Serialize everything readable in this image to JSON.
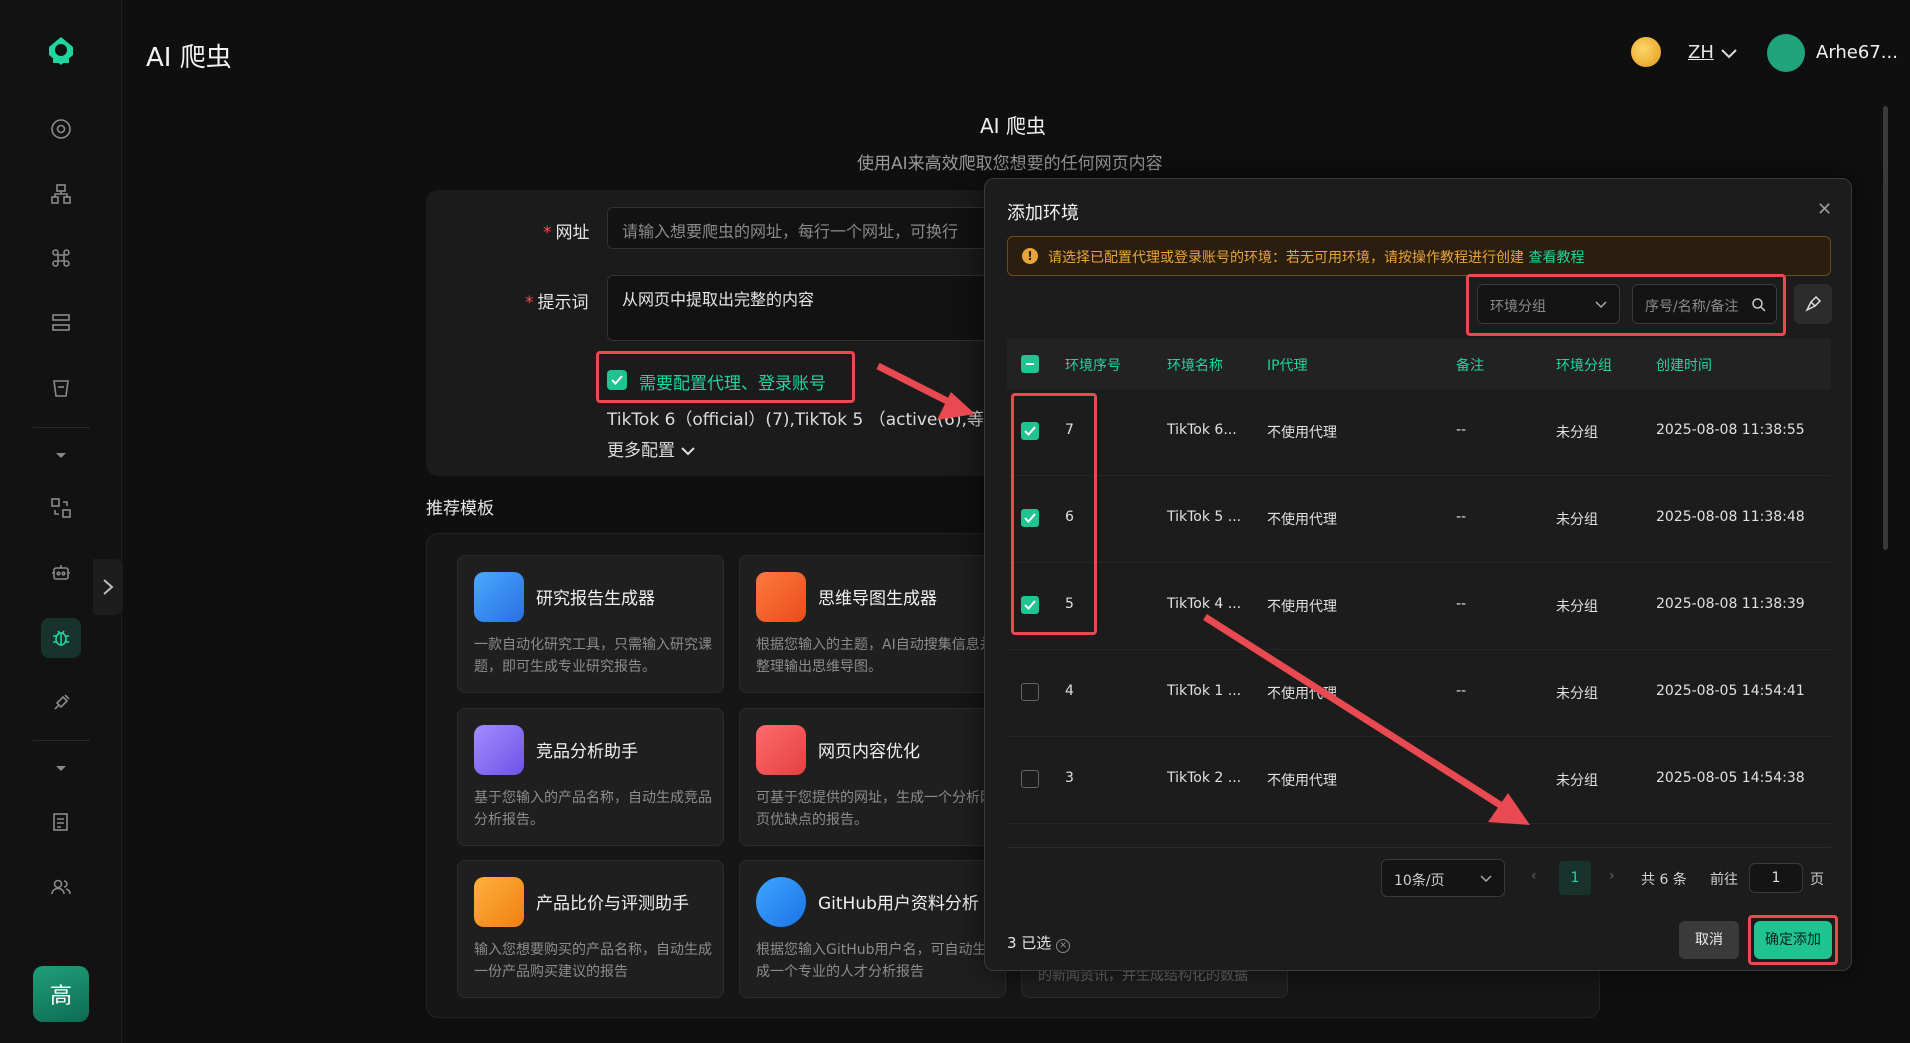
{
  "app": {
    "title": "AI 爬虫"
  },
  "header": {
    "lang": "ZH",
    "user": "Arhe67..."
  },
  "sidebar": {
    "footer_avatar": "高"
  },
  "main": {
    "title": "AI 爬虫",
    "subtitle": "使用AI来高效爬取您想要的任何网页内容",
    "url_label": "网址",
    "url_placeholder": "请输入想要爬虫的网址，每行一个网址，可换行",
    "prompt_label": "提示词",
    "prompt_value": "从网页中提取出完整的内容",
    "proxy_checkbox_label": "需要配置代理、登录账号",
    "selected_envs": "TikTok 6（official）(7),TikTok 5 （active(6),等",
    "more_config": "更多配置",
    "templates_title": "推荐模板",
    "templates": [
      {
        "title": "研究报告生成器",
        "desc": "一款自动化研究工具，只需输入研究课题，即可生成专业研究报告。"
      },
      {
        "title": "思维导图生成器",
        "desc": "根据您输入的主题，AI自动搜集信息并整理输出思维导图。"
      },
      {
        "title": "竞品分析助手",
        "desc": "基于您输入的产品名称，自动生成竞品分析报告。"
      },
      {
        "title": "网页内容优化",
        "desc": "可基于您提供的网址，生成一个分析网页优缺点的报告。"
      },
      {
        "title": "产品比价与评测助手",
        "desc": "输入您想要购买的产品名称，自动生成一份产品购买建议的报告"
      },
      {
        "title": "GitHub用户资料分析",
        "desc": "根据您输入GitHub用户名，可自动生成一个专业的人才分析报告"
      }
    ],
    "partial_card_text": "的新闻资讯，并生成结构化的数据"
  },
  "modal": {
    "title": "添加环境",
    "alert": "请选择已配置代理或登录账号的环境：若无可用环境，请按操作教程进行创建",
    "alert_link": "查看教程",
    "group_select": "环境分组",
    "search_placeholder": "序号/名称/备注",
    "columns": [
      "环境序号",
      "环境名称",
      "IP代理",
      "备注",
      "环境分组",
      "创建时间"
    ],
    "rows": [
      {
        "checked": true,
        "id": "7",
        "name": "TikTok 6...",
        "proxy": "不使用代理",
        "note": "--",
        "group": "未分组",
        "created": "2025-08-08 11:38:55"
      },
      {
        "checked": true,
        "id": "6",
        "name": "TikTok 5 ...",
        "proxy": "不使用代理",
        "note": "--",
        "group": "未分组",
        "created": "2025-08-08 11:38:48"
      },
      {
        "checked": true,
        "id": "5",
        "name": "TikTok 4 ...",
        "proxy": "不使用代理",
        "note": "--",
        "group": "未分组",
        "created": "2025-08-08 11:38:39"
      },
      {
        "checked": false,
        "id": "4",
        "name": "TikTok 1 ...",
        "proxy": "不使用代理",
        "note": "--",
        "group": "未分组",
        "created": "2025-08-05 14:54:41"
      },
      {
        "checked": false,
        "id": "3",
        "name": "TikTok 2 ...",
        "proxy": "不使用代理",
        "note": "",
        "group": "未分组",
        "created": "2025-08-05 14:54:38"
      }
    ],
    "page_size": "10条/页",
    "current_page": "1",
    "total": "共 6 条",
    "goto_label": "前往",
    "goto_value": "1",
    "page_unit": "页",
    "selected_count": "3 已选",
    "cancel": "取消",
    "confirm": "确定添加"
  },
  "colors": {
    "accent": "#1fc491",
    "annotation": "#e94950",
    "warning": "#e8a33a"
  }
}
